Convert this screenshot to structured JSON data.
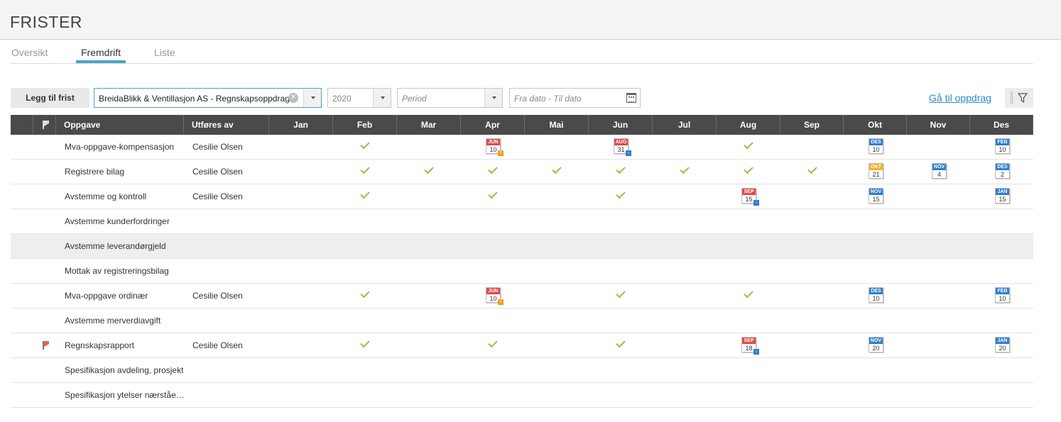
{
  "header": {
    "title": "FRISTER"
  },
  "tabs": [
    {
      "label": "Oversikt",
      "active": false
    },
    {
      "label": "Fremdrift",
      "active": true
    },
    {
      "label": "Liste",
      "active": false
    }
  ],
  "toolbar": {
    "add_label": "Legg til frist",
    "company_value": "BreidaBlikk & Ventillasjon AS - Regnskapsoppdrag",
    "year_value": "2020",
    "period_placeholder": "Period",
    "daterange_placeholder": "Fra dato - Til dato",
    "goto_link": "Gå til oppdrag"
  },
  "colors": {
    "red": "#e04b4b",
    "blue": "#2f7fcf",
    "yellow": "#f2b227",
    "orange": "#f29b1d",
    "check": "#8dc63f",
    "header": "#4a4a4a",
    "accent": "#4aa3c9"
  },
  "table": {
    "headers": {
      "task": "Oppgave",
      "person": "Utføres av",
      "months": [
        "Jan",
        "Feb",
        "Mar",
        "Apr",
        "Mai",
        "Jun",
        "Jul",
        "Aug",
        "Sep",
        "Okt",
        "Nov",
        "Des"
      ]
    },
    "rows": [
      {
        "task": "Mva-oppgave-kompensasjon",
        "person": "Cesilie Olsen",
        "flag": false,
        "highlight": false,
        "cells": [
          null,
          {
            "t": "check"
          },
          null,
          {
            "t": "cal",
            "m": "JUN",
            "d": "10",
            "c": "red",
            "b": "orange"
          },
          null,
          {
            "t": "cal",
            "m": "AUG",
            "d": "31",
            "c": "red",
            "b": "blue"
          },
          null,
          {
            "t": "check"
          },
          null,
          {
            "t": "cal",
            "m": "DES",
            "d": "10",
            "c": "blue"
          },
          null,
          {
            "t": "cal",
            "m": "FEB",
            "d": "10",
            "c": "blue"
          }
        ]
      },
      {
        "task": "Registrere bilag",
        "person": "Cesilie Olsen",
        "flag": false,
        "highlight": false,
        "cells": [
          null,
          {
            "t": "check"
          },
          {
            "t": "check"
          },
          {
            "t": "check"
          },
          {
            "t": "check"
          },
          {
            "t": "check"
          },
          {
            "t": "check"
          },
          {
            "t": "check"
          },
          {
            "t": "check"
          },
          {
            "t": "cal",
            "m": "OKT",
            "d": "21",
            "c": "yellow"
          },
          {
            "t": "cal",
            "m": "NOV",
            "d": "4",
            "c": "blue"
          },
          {
            "t": "cal",
            "m": "DES",
            "d": "2",
            "c": "blue"
          }
        ]
      },
      {
        "task": "Avstemme og kontroll",
        "person": "Cesilie Olsen",
        "flag": false,
        "highlight": false,
        "cells": [
          null,
          {
            "t": "check"
          },
          null,
          {
            "t": "check"
          },
          null,
          {
            "t": "check"
          },
          null,
          {
            "t": "cal",
            "m": "SEP",
            "d": "15",
            "c": "red",
            "b": "blue"
          },
          null,
          {
            "t": "cal",
            "m": "NOV",
            "d": "15",
            "c": "blue"
          },
          null,
          {
            "t": "cal",
            "m": "JAN",
            "d": "15",
            "c": "blue"
          }
        ]
      },
      {
        "task": "Avstemme kunderfordringer",
        "person": "",
        "flag": false,
        "highlight": false,
        "cells": []
      },
      {
        "task": "Avstemme leverandørgjeld",
        "person": "",
        "flag": false,
        "highlight": true,
        "cells": []
      },
      {
        "task": "Mottak av registreringsbilag",
        "person": "",
        "flag": false,
        "highlight": false,
        "cells": []
      },
      {
        "task": "Mva-oppgave ordinær",
        "person": "Cesilie Olsen",
        "flag": false,
        "highlight": false,
        "cells": [
          null,
          {
            "t": "check"
          },
          null,
          {
            "t": "cal",
            "m": "JUN",
            "d": "10",
            "c": "red",
            "b": "orange"
          },
          null,
          {
            "t": "check"
          },
          null,
          {
            "t": "check"
          },
          null,
          {
            "t": "cal",
            "m": "DES",
            "d": "10",
            "c": "blue"
          },
          null,
          {
            "t": "cal",
            "m": "FEB",
            "d": "10",
            "c": "blue"
          }
        ]
      },
      {
        "task": "Avstemme merverdiavgift",
        "person": "",
        "flag": false,
        "highlight": false,
        "cells": []
      },
      {
        "task": "Regnskapsrapport",
        "person": "Cesilie Olsen",
        "flag": true,
        "highlight": false,
        "cells": [
          null,
          {
            "t": "check"
          },
          null,
          {
            "t": "check"
          },
          null,
          {
            "t": "check"
          },
          null,
          {
            "t": "cal",
            "m": "SEP",
            "d": "18",
            "c": "red",
            "b": "blue"
          },
          null,
          {
            "t": "cal",
            "m": "NOV",
            "d": "20",
            "c": "blue"
          },
          null,
          {
            "t": "cal",
            "m": "JAN",
            "d": "20",
            "c": "blue"
          }
        ]
      },
      {
        "task": "Spesifikasjon avdeling, prosjekt",
        "person": "",
        "flag": false,
        "highlight": false,
        "cells": []
      },
      {
        "task": "Spesifikasjon ytelser nærstående",
        "person": "",
        "flag": false,
        "highlight": false,
        "cells": []
      }
    ]
  }
}
